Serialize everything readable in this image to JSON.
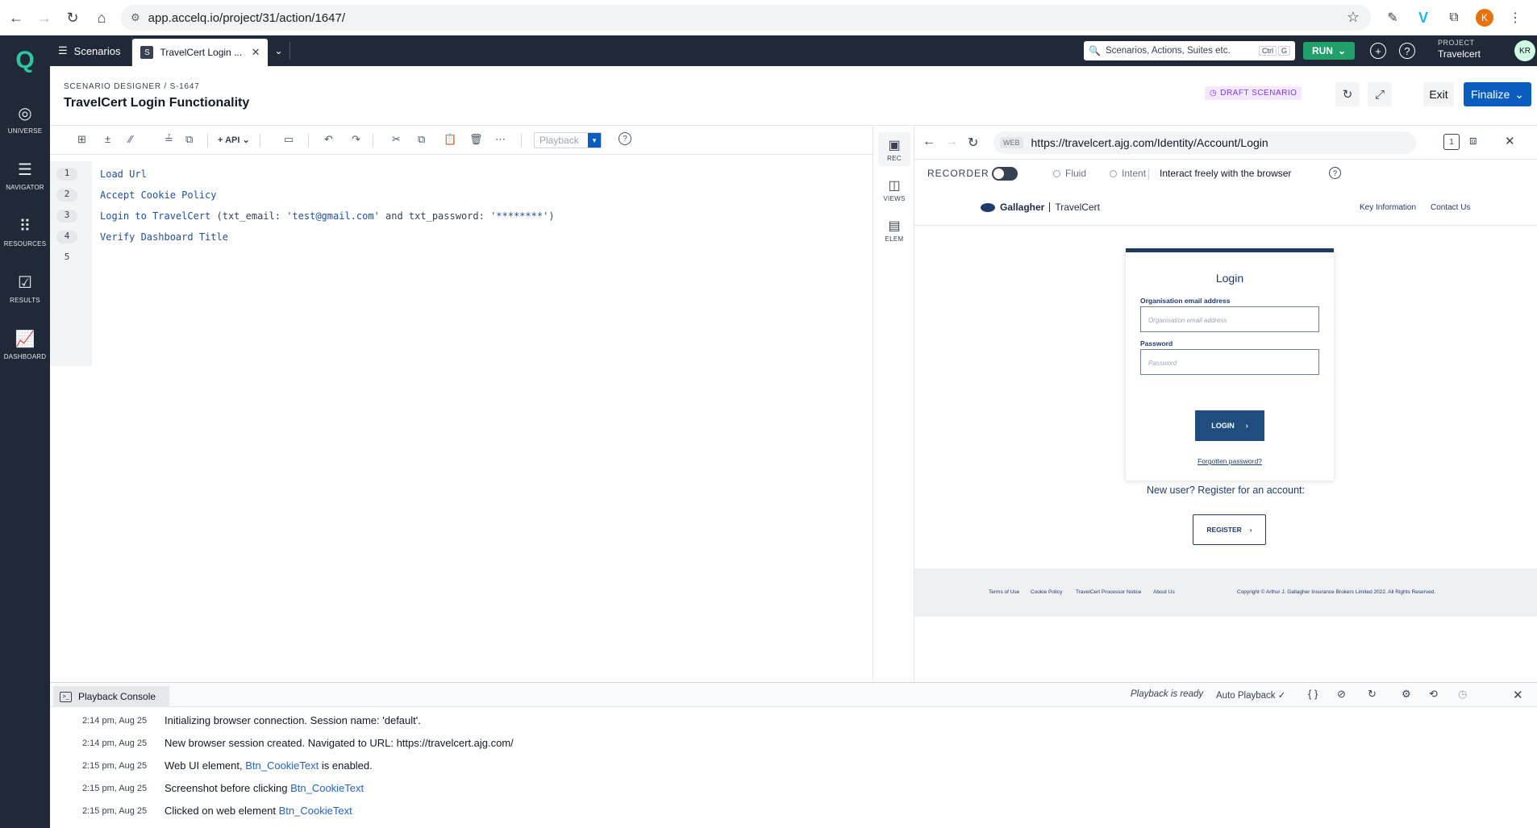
{
  "browser": {
    "url": "app.accelq.io/project/31/action/1647/",
    "avatar": "K"
  },
  "sidebar": {
    "logo": "Q",
    "items": [
      {
        "label": "UNIVERSE"
      },
      {
        "label": "NAVIGATOR"
      },
      {
        "label": "RESOURCES"
      },
      {
        "label": "RESULTS"
      },
      {
        "label": "DASHBOARD"
      }
    ]
  },
  "topbar": {
    "scenarios_label": "Scenarios",
    "tab_label": "TravelCert Login ...",
    "tab_icon": "S",
    "search_placeholder": "Scenarios, Actions, Suites etc.",
    "kbd1": "Ctrl",
    "kbd2": "G",
    "run_label": "RUN",
    "project_label": "PROJECT",
    "project_name": "Travelcert",
    "user_initials": "KR"
  },
  "header": {
    "breadcrumb": "SCENARIO DESIGNER / S-1647",
    "title": "TravelCert Login Functionality",
    "badge": "DRAFT SCENARIO",
    "exit_label": "Exit",
    "finalize_label": "Finalize"
  },
  "editor": {
    "toolbar": {
      "api_label": "+ API",
      "playback_label": "Playback"
    },
    "line_numbers": [
      "1",
      "2",
      "3",
      "4",
      "5"
    ],
    "lines": [
      {
        "text": "Load Url"
      },
      {
        "text": "Accept Cookie Policy"
      },
      {
        "pre": "Login to TravelCert",
        "p1": " (txt_email: ",
        "s1": "'test@gmail.com'",
        "p2": " and txt_password: ",
        "s2": "'********'",
        "p3": ")"
      },
      {
        "text": "Verify Dashboard Title"
      }
    ]
  },
  "rail": {
    "items": [
      {
        "label": "REC"
      },
      {
        "label": "VIEWS"
      },
      {
        "label": "ELEM"
      }
    ]
  },
  "web_panel": {
    "web_tag": "WEB",
    "url": "https://travelcert.ajg.com/Identity/Account/Login",
    "tab_count": "1",
    "recorder_label": "RECORDER",
    "mode_fluid": "Fluid",
    "mode_intent": "Intent",
    "interact_label": "Interact freely with the browser"
  },
  "site": {
    "logo_left": "Gallagher",
    "logo_right": "TravelCert",
    "nav_key_info": "Key Information",
    "nav_contact": "Contact Us",
    "login_title": "Login",
    "email_label": "Organisation email address",
    "email_placeholder": "Organisation email address",
    "password_label": "Password",
    "password_placeholder": "Password",
    "login_button": "LOGIN",
    "forgot_link": "Forgotten password?",
    "new_user_text": "New user? Register for an account:",
    "register_button": "REGISTER",
    "footer": {
      "terms": "Terms of Use",
      "cookie": "Cookie Policy",
      "processor": "TravelCert Processor Notice",
      "about": "About Us",
      "copyright": "Copyright © Arthur J. Gallagher Insurance Brokers Limited 2022. All Rights Reserved."
    }
  },
  "console": {
    "tab_label": "Playback Console",
    "status": "Playback is ready",
    "auto_playback": "Auto Playback",
    "logs": [
      {
        "time": "2:14 pm, Aug 25",
        "pre": "Initializing browser connection. Session name: 'default'.",
        "link": "",
        "post": ""
      },
      {
        "time": "2:14 pm, Aug 25",
        "pre": "New browser session created. Navigated to URL: https://travelcert.ajg.com/",
        "link": "",
        "post": ""
      },
      {
        "time": "2:15 pm, Aug 25",
        "pre": "Web UI element, ",
        "link": "Btn_CookieText",
        "post": " is enabled."
      },
      {
        "time": "2:15 pm, Aug 25",
        "pre": "Screenshot before clicking ",
        "link": "Btn_CookieText",
        "post": ""
      },
      {
        "time": "2:15 pm, Aug 25",
        "pre": "Clicked on web element ",
        "link": "Btn_CookieText",
        "post": ""
      }
    ]
  }
}
